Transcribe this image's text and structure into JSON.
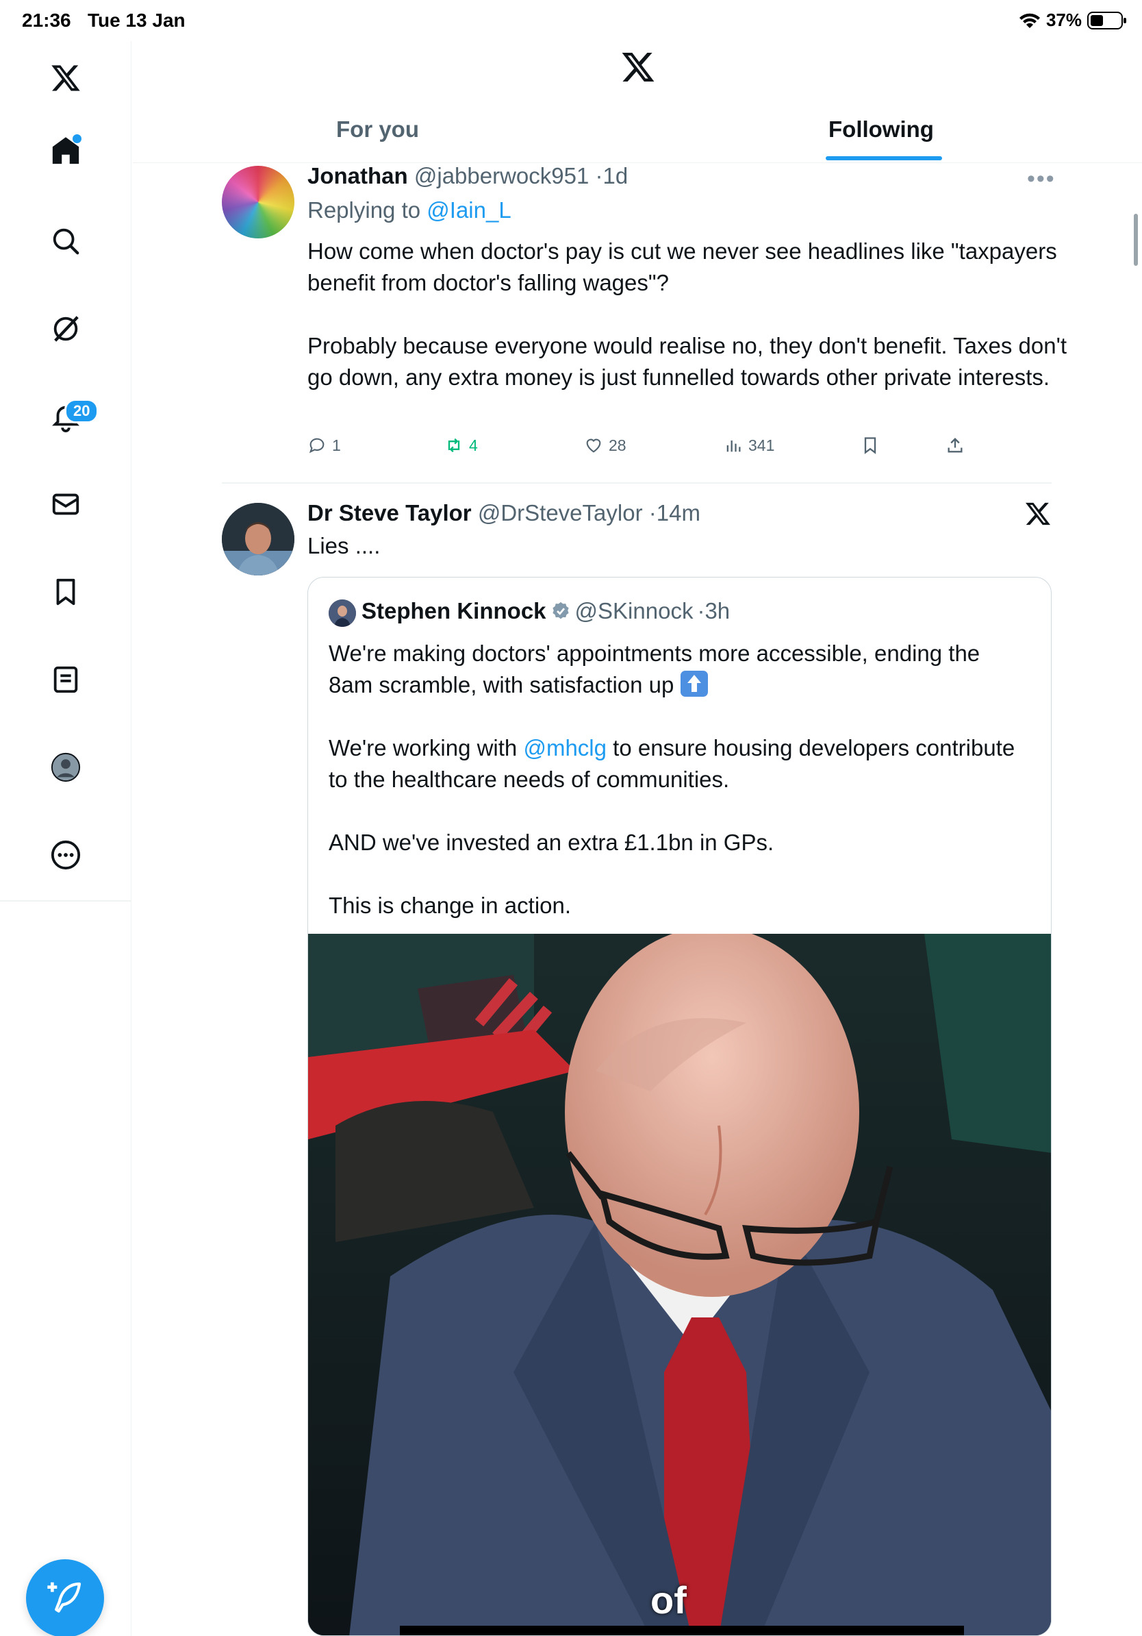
{
  "status_bar": {
    "time": "21:36",
    "date": "Tue 13 Jan",
    "battery_text": "37%",
    "battery_level": 0.37
  },
  "sidebar": {
    "items": [
      {
        "name": "home",
        "icon": "home-icon"
      },
      {
        "name": "explore",
        "icon": "search-icon"
      },
      {
        "name": "grok",
        "icon": "grok-icon"
      },
      {
        "name": "notifications",
        "icon": "bell-icon",
        "badge": "20"
      },
      {
        "name": "messages",
        "icon": "mail-icon"
      },
      {
        "name": "bookmarks",
        "icon": "bookmark-icon"
      },
      {
        "name": "lists",
        "icon": "list-icon"
      },
      {
        "name": "profile",
        "icon": "profile-icon"
      },
      {
        "name": "more",
        "icon": "more-icon"
      }
    ],
    "compose_icon": "compose-icon"
  },
  "header": {
    "tabs": [
      {
        "label": "For you",
        "selected": false
      },
      {
        "label": "Following",
        "selected": true
      }
    ]
  },
  "tweets": [
    {
      "name": "Jonathan",
      "handle": "@jabberwock951",
      "time": "1d",
      "replying_prefix": "Replying to",
      "replying_to": "@Iain_L",
      "text_p1": "How come when doctor's pay is cut we never see headlines like \"taxpayers benefit from doctor's falling wages\"?",
      "text_p2": "Probably because everyone would realise no, they don't benefit. Taxes don't go down, any extra money is just funnelled towards other private interests.",
      "replies": "1",
      "reposts": "4",
      "likes": "28",
      "views": "341"
    },
    {
      "name": "Dr Steve Taylor",
      "handle": "@DrSteveTaylor",
      "time": "14m",
      "text": "Lies ....",
      "quote": {
        "name": "Stephen Kinnock",
        "handle": "@SKinnock",
        "time": "3h",
        "p1": "We're making doctors' appointments more accessible, ending the 8am scramble, with satisfaction up",
        "p2_prefix": "We're working with",
        "p2_mention": "@mhclg",
        "p2_suffix": "to ensure housing developers contribute to the healthcare needs of communities.",
        "p3": "AND we've invested an extra £1.1bn in GPs.",
        "p4": "This is change in action.",
        "video_caption": "of"
      }
    }
  ],
  "colors": {
    "accent": "#1d9bf0",
    "repost": "#00ba7c",
    "muted": "#536471"
  }
}
